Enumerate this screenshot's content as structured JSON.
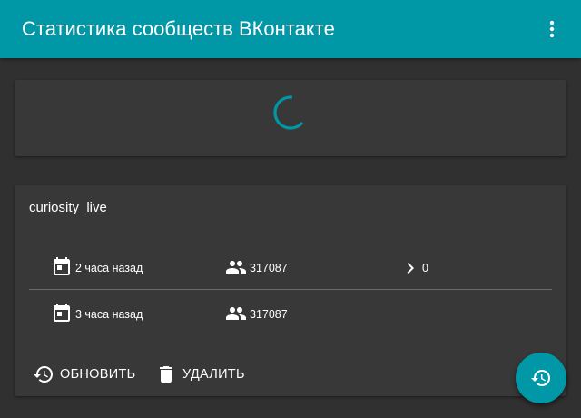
{
  "appbar": {
    "title": "Статистика сообществ ВКонтакте",
    "menu_icon": "more-vert-icon"
  },
  "loading_card": {
    "spinner_icon": "loading-spinner-icon"
  },
  "group_card": {
    "name": "curiosity_live",
    "rows": [
      {
        "date_icon": "event-icon",
        "date": "2 часа назад",
        "members_icon": "people-icon",
        "members": "317087",
        "change_icon": "chevron-right-icon",
        "change": "0"
      },
      {
        "date_icon": "event-icon",
        "date": "3 часа назад",
        "members_icon": "people-icon",
        "members": "317087"
      }
    ],
    "actions": {
      "refresh_label": "ОБНОВИТЬ",
      "refresh_icon": "refresh-icon",
      "delete_label": "УДАЛИТЬ",
      "delete_icon": "delete-icon"
    }
  },
  "fab": {
    "icon": "refresh-icon"
  },
  "colors": {
    "accent": "#0097a7",
    "background": "#303030",
    "card": "#383838",
    "text": "#ffffff",
    "divider": "#6a6a6a"
  }
}
